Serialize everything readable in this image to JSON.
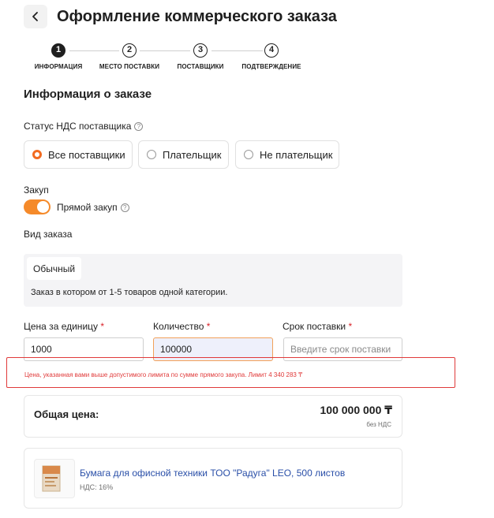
{
  "header": {
    "title": "Оформление коммерческого заказа"
  },
  "stepper": {
    "steps": [
      {
        "number": "1",
        "label": "ИНФОРМАЦИЯ"
      },
      {
        "number": "2",
        "label": "МЕСТО ПОСТАВКИ"
      },
      {
        "number": "3",
        "label": "ПОСТАВЩИКИ"
      },
      {
        "number": "4",
        "label": "ПОДТВЕРЖДЕНИЕ"
      }
    ],
    "active_step": 1
  },
  "section": {
    "title": "Информация о заказе"
  },
  "vat_status": {
    "label": "Статус НДС поставщика",
    "options": [
      "Все поставщики",
      "Плательщик",
      "Не плательщик"
    ],
    "selected": "Все поставщики"
  },
  "purchase": {
    "label": "Закуп",
    "toggle_label": "Прямой закуп",
    "toggle_on": true
  },
  "order_type": {
    "label": "Вид заказа",
    "selected": "Обычный",
    "description": "Заказ в котором от 1-5 товаров одной категории."
  },
  "inputs": {
    "price": {
      "label": "Цена за единицу",
      "required_mark": "*",
      "value": "1000"
    },
    "quantity": {
      "label": "Количество",
      "required_mark": "*",
      "value": "100000"
    },
    "delivery": {
      "label": "Срок поставки",
      "required_mark": "*",
      "placeholder": "Введите срок поставки",
      "value": ""
    }
  },
  "error": {
    "text": "Цена, указанная вами выше допустимого лимита по сумме прямого закупа. Лимит 4 340 283 ₸"
  },
  "total": {
    "label": "Общая цена:",
    "amount": "100 000 000 ₸",
    "vat_note": "без НДС"
  },
  "product": {
    "name": "Бумага для офисной техники ТОО \"Радуга\" LEO, 500 листов",
    "vat": "НДС: 16%"
  },
  "colors": {
    "accent": "#f26b21",
    "toggle": "#f58a2a",
    "error": "#e03a3a",
    "link": "#2a4fa8"
  },
  "icons": {
    "back": "chevron-left-icon",
    "help": "question-circle-icon",
    "product_image": "paper-pack-image"
  }
}
